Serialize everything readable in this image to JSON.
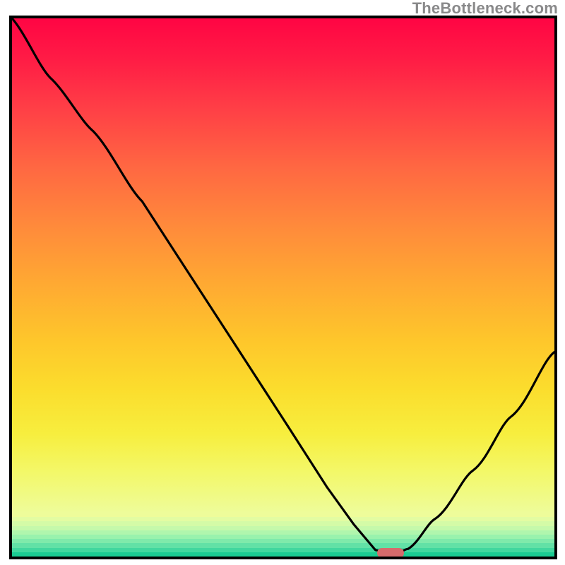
{
  "watermark": "TheBottleneck.com",
  "colors": {
    "frame": "#000000",
    "curve": "#000000",
    "marker": "#d66b6c",
    "gradient_top": "#ff0544",
    "gradient_bottom": "#1acb92"
  },
  "chart_data": {
    "type": "line",
    "title": "",
    "xlabel": "",
    "ylabel": "",
    "xlim": [
      0,
      100
    ],
    "ylim": [
      0,
      100
    ],
    "grid": false,
    "note": "x is horizontal position in % of plot width (left→right); y is bottleneck severity in %, 0 = ideal (green floor), 100 = worst (red top). The curve descends from top-left, reaches ~0 near x≈69, then rises again.",
    "series": [
      {
        "name": "bottleneck-curve",
        "x": [
          0,
          7,
          15,
          24,
          33,
          42,
          51,
          58,
          63,
          67,
          69,
          71,
          73,
          78,
          85,
          92,
          100
        ],
        "y": [
          100,
          89,
          79,
          66,
          52,
          38,
          24,
          13,
          6,
          1.2,
          0.6,
          0.6,
          1.4,
          7,
          16,
          26,
          38
        ]
      }
    ],
    "marker": {
      "x": 69.8,
      "y": 0.6
    },
    "segment_hints": {
      "inflection_x": 24,
      "flat_start_x": 67,
      "flat_end_x": 73
    }
  }
}
